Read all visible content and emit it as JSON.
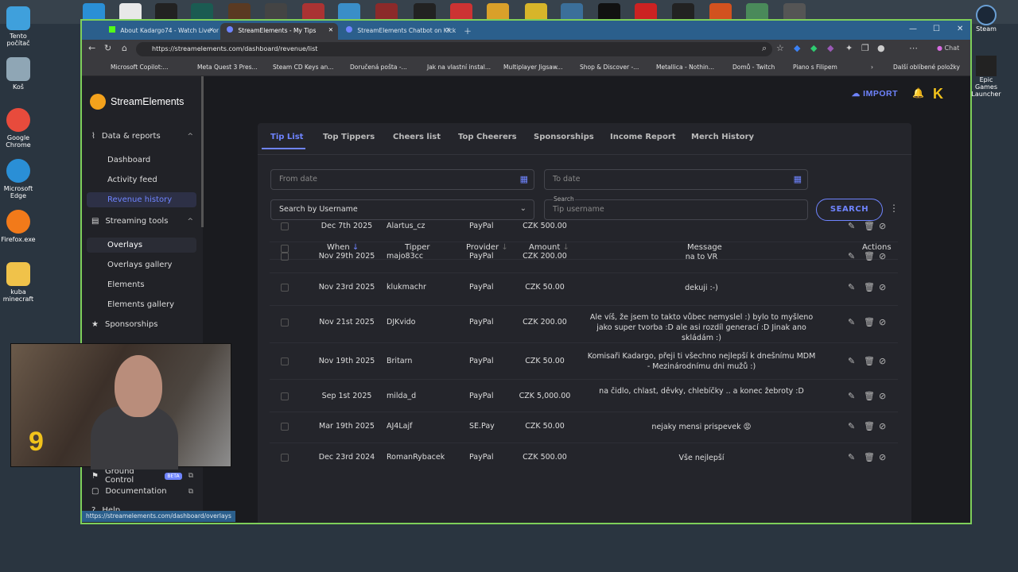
{
  "desktop": {
    "icons": [
      {
        "label": "Tento počítač"
      },
      {
        "label": "Koš"
      },
      {
        "label": "Google Chrome"
      },
      {
        "label": "Microsoft Edge"
      },
      {
        "label": "Firefox.exe"
      },
      {
        "label": "kuba minecraft"
      }
    ],
    "right_labels": [
      "Steam",
      "Epic Games Launcher"
    ]
  },
  "browser": {
    "tabs": [
      {
        "label": "About Kadargo74 - Watch Live on Kick"
      },
      {
        "label": "StreamElements - My Tips"
      },
      {
        "label": "StreamElements Chatbot on Kick"
      }
    ],
    "url": "https://streamelements.com/dashboard/revenue/list",
    "chat_label": "Chat",
    "bookmarks": [
      "Microsoft Copilot:...",
      "Meta Quest 3 Pres...",
      "Steam CD Keys an...",
      "Doručená pošta -...",
      "Jak na vlastní instal...",
      "Multiplayer Jigsaw...",
      "Shop & Discover -...",
      "Metallica - Nothin...",
      "Domů - Twitch",
      "Piano s Filipem"
    ],
    "other_bookmarks": "Další oblíbené položky",
    "status_url": "https://streamelements.com/dashboard/overlays"
  },
  "sidebar": {
    "brand": "StreamElements",
    "sections": [
      {
        "label": "Data & reports"
      },
      {
        "label": "Streaming tools"
      },
      {
        "label": "Sponsorships"
      }
    ],
    "items": [
      {
        "label": "Dashboard"
      },
      {
        "label": "Activity feed"
      },
      {
        "label": "Revenue history"
      },
      {
        "label": "Overlays"
      },
      {
        "label": "Overlays gallery"
      },
      {
        "label": "Elements"
      },
      {
        "label": "Elements gallery"
      }
    ],
    "bottom": [
      {
        "label": "Ground Control",
        "badge": "BETA"
      },
      {
        "label": "Documentation"
      },
      {
        "label": "Help"
      }
    ]
  },
  "header": {
    "import_label": "IMPORT",
    "avatar_letter": "K"
  },
  "revenue": {
    "tabs": [
      "Tip List",
      "Top Tippers",
      "Cheers list",
      "Top Cheerers",
      "Sponsorships",
      "Income Report",
      "Merch History"
    ],
    "from_date_placeholder": "From date",
    "to_date_placeholder": "To date",
    "search_by": "Search by Username",
    "search_label": "Search",
    "search_placeholder": "Tip username",
    "search_button": "SEARCH",
    "columns": [
      "When",
      "Tipper",
      "Provider",
      "Amount",
      "Message",
      "Actions"
    ],
    "rows": [
      {
        "when": "Dec 7th 2025",
        "tipper": "Alartus_cz",
        "provider": "PayPal",
        "amount": "CZK 500.00",
        "message": ""
      },
      {
        "when": "Nov 29th 2025",
        "tipper": "majo83cc",
        "provider": "PayPal",
        "amount": "CZK 200.00",
        "message": "na to VR"
      },
      {
        "when": "Nov 23rd 2025",
        "tipper": "klukmachr",
        "provider": "PayPal",
        "amount": "CZK 50.00",
        "message": "dekuji :-)"
      },
      {
        "when": "Nov 21st 2025",
        "tipper": "DJKvido",
        "provider": "PayPal",
        "amount": "CZK 200.00",
        "message": "Ale víš, že jsem to takto vůbec nemyslel :) bylo to myšleno jako super tvorba :D ale asi rozdíl generací :D Jinak ano skládám :)"
      },
      {
        "when": "Nov 19th 2025",
        "tipper": "Britarn",
        "provider": "PayPal",
        "amount": "CZK 50.00",
        "message": "Komisaři Kadargo, přeji ti všechno nejlepší k dnešnímu MDM - Mezinárodnímu dni mužů :)"
      },
      {
        "when": "Sep 1st 2025",
        "tipper": "milda_d",
        "provider": "PayPal",
        "amount": "CZK 5,000.00",
        "message": "na čidlo, chlast, děvky, chlebíčky .. a konec žebroty :D"
      },
      {
        "when": "Mar 19th 2025",
        "tipper": "AJ4Lajf",
        "provider": "SE.Pay",
        "amount": "CZK 50.00",
        "message": "nejaky mensi prispevek 😡"
      },
      {
        "when": "Dec 23rd 2024",
        "tipper": "RomanRybacek",
        "provider": "PayPal",
        "amount": "CZK 500.00",
        "message": "Vše nejlepší"
      }
    ]
  },
  "webcam": {
    "overlay_number": "9"
  },
  "colors": {
    "accent": "#6f84ff",
    "border": "#7ecf5a",
    "bg": "#1a1b1f"
  }
}
